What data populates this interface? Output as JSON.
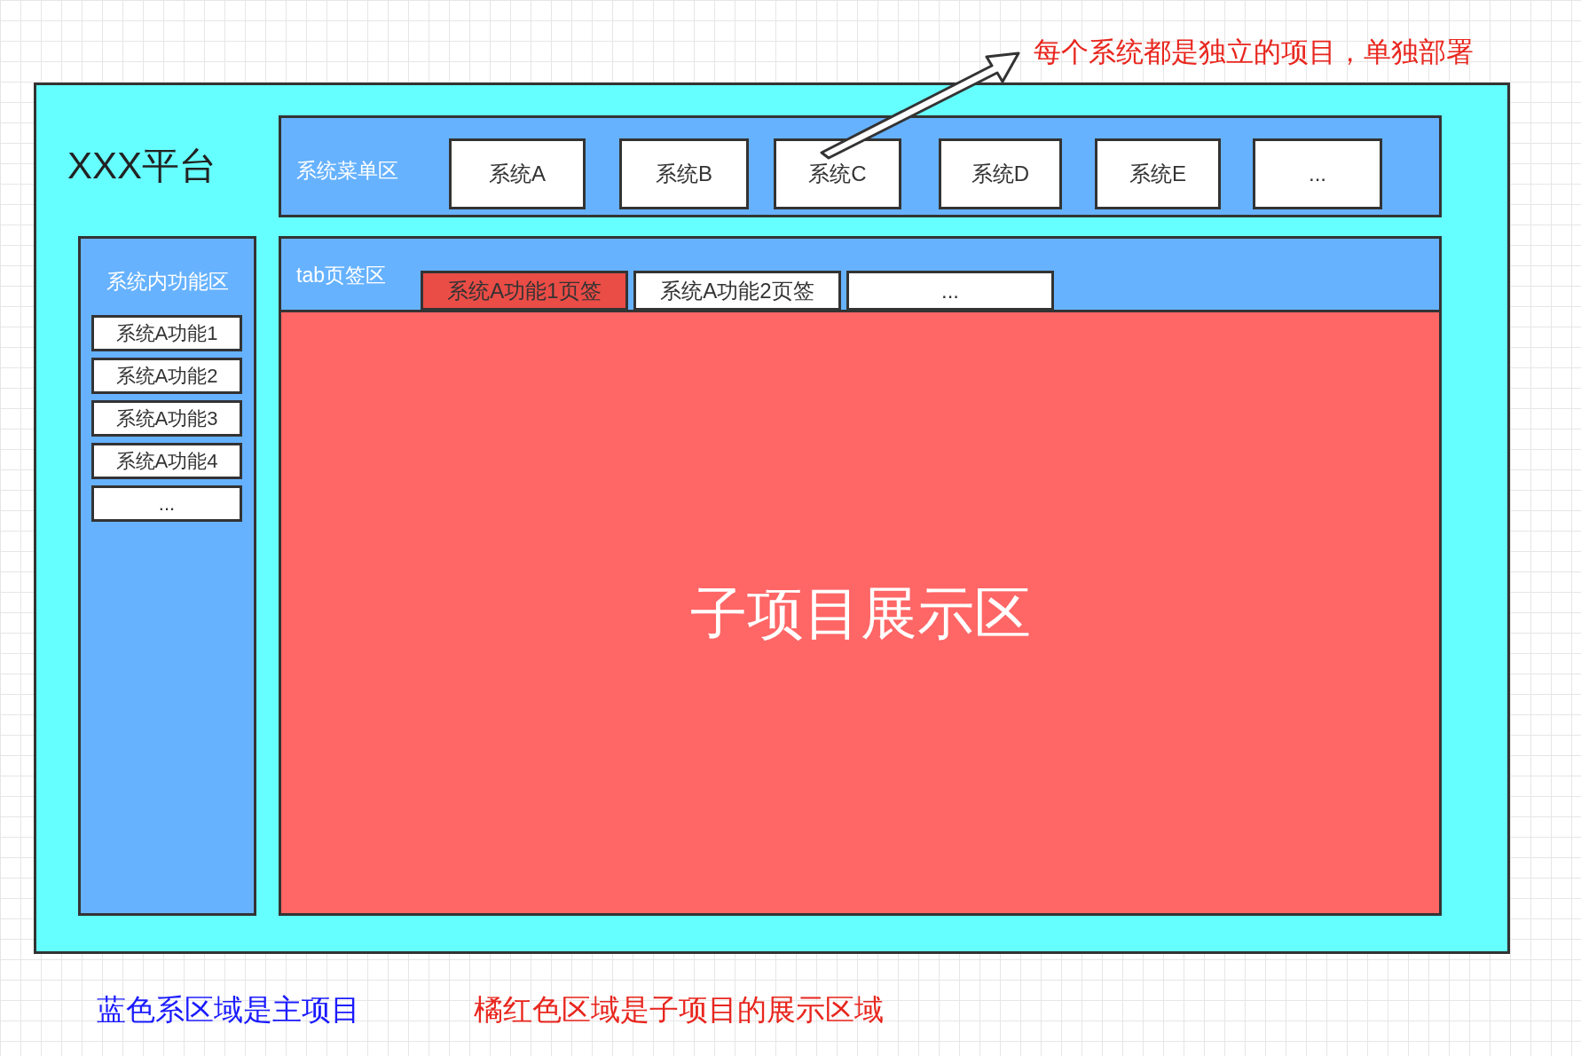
{
  "platform_title": "XXX平台",
  "annotation": "每个系统都是独立的项目，单独部署",
  "system_menu": {
    "label": "系统菜单区",
    "systems": [
      "系统A",
      "系统B",
      "系统C",
      "系统D",
      "系统E",
      "..."
    ]
  },
  "function_panel": {
    "label": "系统内功能区",
    "items": [
      "系统A功能1",
      "系统A功能2",
      "系统A功能3",
      "系统A功能4",
      "..."
    ]
  },
  "tab_area": {
    "label": "tab页签区",
    "tabs": [
      {
        "label": "系统A功能1页签",
        "selected": true
      },
      {
        "label": "系统A功能2页签",
        "selected": false
      },
      {
        "label": "...",
        "selected": false
      }
    ]
  },
  "display_area": {
    "label": "子项目展示区"
  },
  "legend": [
    {
      "text": "蓝色系区域是主项目",
      "color": "#1a1aff"
    },
    {
      "text": "橘红色区域是子项目的展示区域",
      "color": "#e8261e"
    }
  ]
}
